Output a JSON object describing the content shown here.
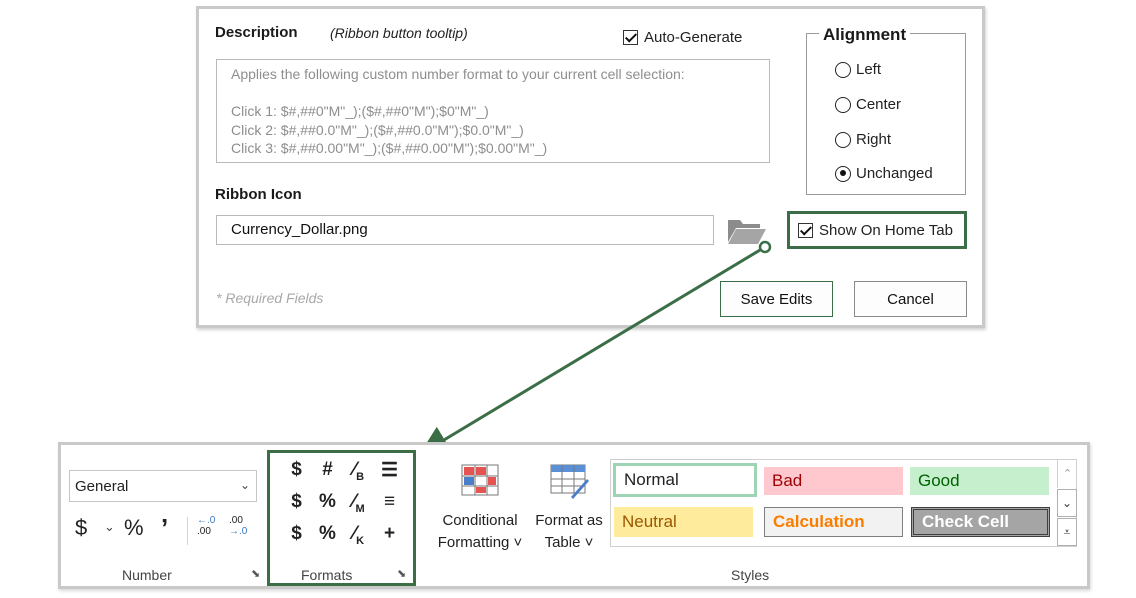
{
  "dialog": {
    "description_label": "Description",
    "tooltip_note": "(Ribbon button tooltip)",
    "auto_generate_label": "Auto-Generate",
    "description_text": "Applies the following custom number format to your current cell selection:\n\nClick 1: $#,##0\"M\"_);($#,##0\"M\");$0\"M\"_)\nClick 2: $#,##0.0\"M\"_);($#,##0.0\"M\");$0.0\"M\"_)\nClick 3: $#,##0.00\"M\"_);($#,##0.00\"M\");$0.00\"M\"_)",
    "ribbon_icon_label": "Ribbon Icon",
    "ribbon_icon_value": "Currency_Dollar.png",
    "show_on_home_tab_label": "Show On Home Tab",
    "required_note": "* Required Fields",
    "save_label": "Save Edits",
    "cancel_label": "Cancel",
    "alignment": {
      "title": "Alignment",
      "options": [
        "Left",
        "Center",
        "Right",
        "Unchanged"
      ],
      "selected": "Unchanged"
    }
  },
  "ribbon": {
    "number": {
      "format_value": "General",
      "currency_symbol": "$",
      "percent_symbol": "%",
      "comma_symbol": "’",
      "increase_decimal": ".00",
      "decrease_decimal": ".00",
      "group_label": "Number"
    },
    "formats": {
      "group_label": "Formats",
      "icons": [
        {
          "text": "$",
          "sub": ""
        },
        {
          "text": "#",
          "sub": ""
        },
        {
          "text": "⁄",
          "sub": "B"
        },
        {
          "text": "☰",
          "sub": ""
        },
        {
          "text": "$",
          "sub": ""
        },
        {
          "text": "%",
          "sub": ""
        },
        {
          "text": "⁄",
          "sub": "M"
        },
        {
          "text": "≡",
          "sub": ""
        },
        {
          "text": "$",
          "sub": ""
        },
        {
          "text": "%",
          "sub": ""
        },
        {
          "text": "⁄",
          "sub": "K"
        },
        {
          "text": "+",
          "sub": ""
        }
      ]
    },
    "conditional_formatting": {
      "line1": "Conditional",
      "line2": "Formatting ˅"
    },
    "format_as_table": {
      "line1": "Format as",
      "line2": "Table ˅"
    },
    "styles": {
      "group_label": "Styles",
      "cells": [
        {
          "label": "Normal",
          "bg": "#ffffff",
          "color": "#000000"
        },
        {
          "label": "Bad",
          "bg": "#ffc7ce",
          "color": "#9c0006"
        },
        {
          "label": "Good",
          "bg": "#c6efce",
          "color": "#006100"
        },
        {
          "label": "Neutral",
          "bg": "#ffeb9c",
          "color": "#9c5700"
        },
        {
          "label": "Calculation",
          "bg": "#f2f2f2",
          "color": "#fa7d00"
        },
        {
          "label": "Check Cell",
          "bg": "#a5a5a5",
          "color": "#ffffff"
        }
      ]
    }
  },
  "colors": {
    "accent_green": "#3b6e47"
  }
}
